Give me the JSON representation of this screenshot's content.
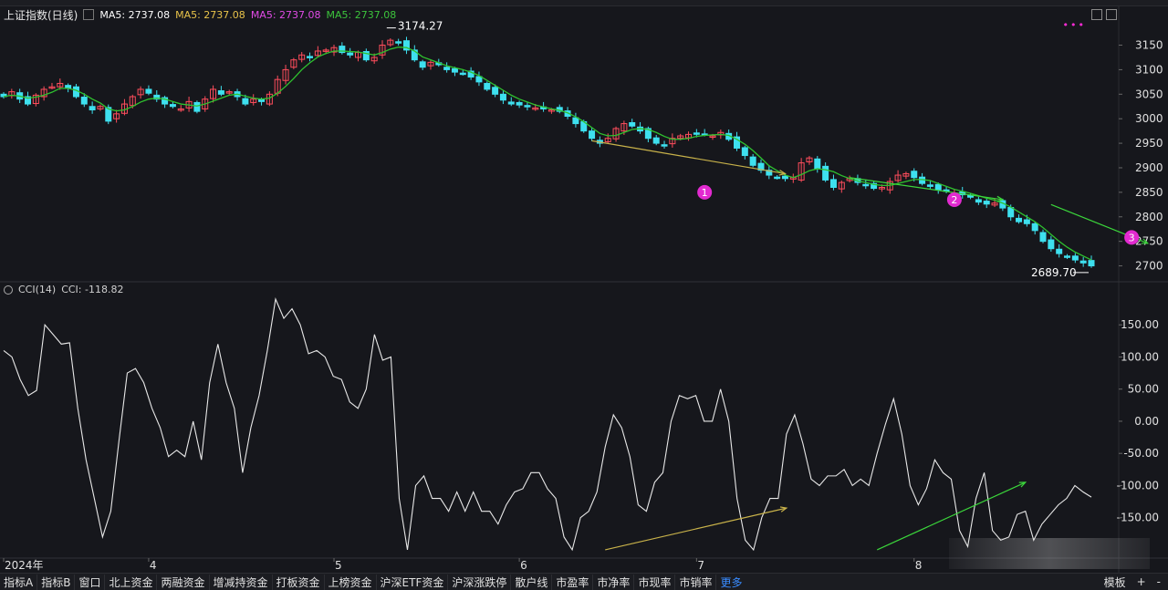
{
  "header": {
    "title": "上证指数(日线)",
    "ma_items": [
      {
        "text": "MA5: 2737.08",
        "color": "#ffffff"
      },
      {
        "text": "MA5: 2737.08",
        "color": "#e8c34a"
      },
      {
        "text": "MA5: 2737.08",
        "color": "#e14be6"
      },
      {
        "text": "MA5: 2737.08",
        "color": "#3cc43c"
      }
    ],
    "more": "•••"
  },
  "indicator": {
    "title": "CCI(14)",
    "value_text": "CCI: -118.82"
  },
  "bottom_bar": {
    "tabs": [
      "指标A",
      "指标B",
      "窗口",
      "北上资金",
      "两融资金",
      "增减持资金",
      "打板资金",
      "上榜资金",
      "沪深ETF资金",
      "沪深涨跌停",
      "散户线",
      "市盈率",
      "市净率",
      "市现率",
      "市销率"
    ],
    "more": "更多",
    "right": [
      "模板",
      "+",
      "-"
    ]
  },
  "colors": {
    "up": "#ff4d5c",
    "down": "#3ee0ef",
    "ma": "#2fc22f",
    "cci": "#e8e8e8",
    "trend_up": "#3bd63b",
    "trend_tan": "#c8b24a",
    "marker": "#e22ad0",
    "grid": "#2a2b30",
    "axis_text": "#e0e0e0"
  },
  "chart_data": [
    {
      "type": "candlestick",
      "title": "上证指数(日线)",
      "y_ticks": [
        3150,
        3100,
        3050,
        3000,
        2950,
        2900,
        2850,
        2800,
        2750,
        2700
      ],
      "ylim": [
        2675,
        3190
      ],
      "x_labels": [
        "2024年",
        "4",
        "5",
        "6",
        "7",
        "8"
      ],
      "annotations": {
        "high": "3174.27",
        "low": "2689.70"
      },
      "markers": [
        "1",
        "2",
        "3"
      ],
      "series_close": [
        3045,
        3055,
        3040,
        3030,
        3048,
        3060,
        3065,
        3072,
        3062,
        3045,
        3030,
        3018,
        3025,
        2995,
        3010,
        3030,
        3045,
        3060,
        3052,
        3040,
        3030,
        3025,
        3020,
        3035,
        3015,
        3040,
        3060,
        3050,
        3055,
        3045,
        3030,
        3040,
        3035,
        3050,
        3080,
        3100,
        3120,
        3130,
        3125,
        3138,
        3140,
        3145,
        3135,
        3130,
        3135,
        3120,
        3125,
        3150,
        3160,
        3155,
        3140,
        3120,
        3105,
        3115,
        3110,
        3100,
        3095,
        3092,
        3085,
        3075,
        3060,
        3050,
        3038,
        3030,
        3028,
        3025,
        3022,
        3020,
        3018,
        3015,
        3005,
        2990,
        2975,
        2960,
        2950,
        2960,
        2980,
        2990,
        2985,
        2975,
        2960,
        2950,
        2945,
        2960,
        2965,
        2968,
        2970,
        2968,
        2965,
        2972,
        2958,
        2940,
        2925,
        2905,
        2895,
        2885,
        2880,
        2878,
        2880,
        2910,
        2920,
        2898,
        2875,
        2860,
        2870,
        2878,
        2870,
        2865,
        2858,
        2860,
        2872,
        2885,
        2888,
        2880,
        2868,
        2862,
        2855,
        2852,
        2848,
        2845,
        2840,
        2830,
        2826,
        2828,
        2818,
        2800,
        2790,
        2786,
        2772,
        2750,
        2735,
        2725,
        2718,
        2712,
        2706,
        2700
      ],
      "series_ma5": [
        3045,
        3048,
        3046,
        3042,
        3044,
        3048,
        3054,
        3062,
        3062,
        3058,
        3050,
        3040,
        3032,
        3020,
        3016,
        3018,
        3025,
        3034,
        3040,
        3042,
        3040,
        3035,
        3030,
        3028,
        3026,
        3030,
        3036,
        3042,
        3048,
        3050,
        3046,
        3042,
        3040,
        3042,
        3052,
        3066,
        3082,
        3100,
        3114,
        3126,
        3133,
        3138,
        3138,
        3137,
        3136,
        3133,
        3130,
        3135,
        3142,
        3146,
        3145,
        3138,
        3126,
        3120,
        3114,
        3108,
        3104,
        3100,
        3095,
        3088,
        3078,
        3068,
        3058,
        3048,
        3040,
        3034,
        3028,
        3024,
        3020,
        3017,
        3012,
        3004,
        2994,
        2982,
        2970,
        2965,
        2966,
        2972,
        2978,
        2980,
        2978,
        2972,
        2964,
        2958,
        2958,
        2960,
        2964,
        2966,
        2967,
        2968,
        2966,
        2958,
        2948,
        2935,
        2920,
        2904,
        2894,
        2885,
        2880,
        2886,
        2894,
        2898,
        2896,
        2892,
        2884,
        2878,
        2873,
        2870,
        2866,
        2864,
        2864,
        2868,
        2872,
        2876,
        2876,
        2874,
        2868,
        2862,
        2856,
        2852,
        2848,
        2843,
        2838,
        2834,
        2828,
        2820,
        2810,
        2800,
        2790,
        2778,
        2764,
        2750,
        2738,
        2728,
        2720,
        2712
      ]
    },
    {
      "type": "line",
      "title": "CCI(14)",
      "y_ticks": [
        150,
        100,
        50,
        0,
        -50,
        -100,
        -150
      ],
      "ylim": [
        -210,
        190
      ],
      "values": [
        110,
        100,
        65,
        40,
        48,
        150,
        135,
        120,
        122,
        20,
        -60,
        -120,
        -180,
        -140,
        -30,
        75,
        82,
        60,
        20,
        -10,
        -55,
        -45,
        -55,
        0,
        -60,
        60,
        120,
        60,
        20,
        -80,
        -10,
        40,
        110,
        190,
        160,
        175,
        150,
        105,
        110,
        100,
        70,
        65,
        30,
        20,
        50,
        135,
        95,
        100,
        -120,
        -200,
        -100,
        -85,
        -120,
        -120,
        -140,
        -110,
        -140,
        -110,
        -140,
        -140,
        -160,
        -130,
        -110,
        -105,
        -80,
        -80,
        -105,
        -120,
        -180,
        -200,
        -150,
        -140,
        -110,
        -40,
        10,
        -10,
        -55,
        -130,
        -140,
        -95,
        -80,
        0,
        40,
        35,
        40,
        0,
        0,
        50,
        0,
        -120,
        -185,
        -200,
        -150,
        -120,
        -120,
        -20,
        10,
        -35,
        -90,
        -100,
        -85,
        -85,
        -75,
        -100,
        -90,
        -100,
        -50,
        -5,
        35,
        -20,
        -100,
        -130,
        -105,
        -60,
        -80,
        -90,
        -170,
        -195,
        -120,
        -80,
        -170,
        -185,
        -180,
        -145,
        -140,
        -185,
        -160,
        -145,
        -130,
        -120,
        -100,
        -110,
        -118
      ]
    }
  ]
}
